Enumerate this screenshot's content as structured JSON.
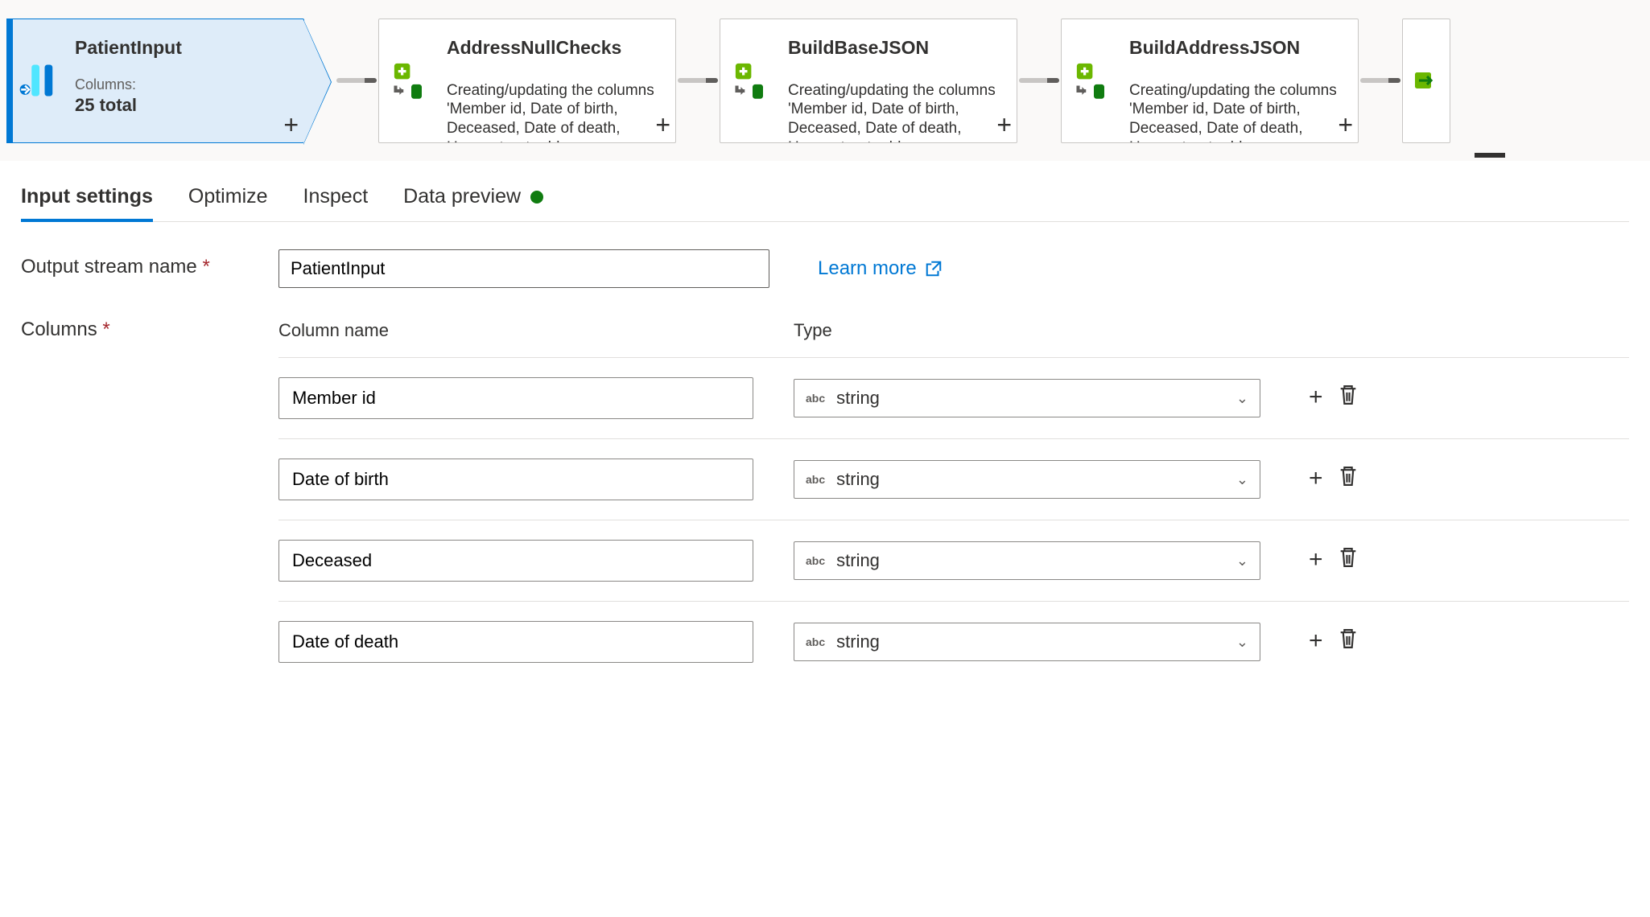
{
  "flow": {
    "selected": {
      "title": "PatientInput",
      "columnsLabel": "Columns:",
      "columnsTotal": "25 total"
    },
    "nodes": [
      {
        "title": "AddressNullChecks",
        "desc": "Creating/updating the columns 'Member id, Date of birth, Deceased, Date of death, Home street address,"
      },
      {
        "title": "BuildBaseJSON",
        "desc": "Creating/updating the columns 'Member id, Date of birth, Deceased, Date of death, Home street address,"
      },
      {
        "title": "BuildAddressJSON",
        "desc": "Creating/updating the columns 'Member id, Date of birth, Deceased, Date of death, Home street address,"
      }
    ]
  },
  "tabs": [
    "Input settings",
    "Optimize",
    "Inspect",
    "Data preview"
  ],
  "form": {
    "outputLabel": "Output stream name",
    "outputValue": "PatientInput",
    "learnMore": "Learn more",
    "columnsLabel": "Columns",
    "headers": {
      "name": "Column name",
      "type": "Type"
    }
  },
  "typePrefix": "abc",
  "columns": [
    {
      "name": "Member id",
      "type": "string"
    },
    {
      "name": "Date of birth",
      "type": "string"
    },
    {
      "name": "Deceased",
      "type": "string"
    },
    {
      "name": "Date of death",
      "type": "string"
    }
  ]
}
